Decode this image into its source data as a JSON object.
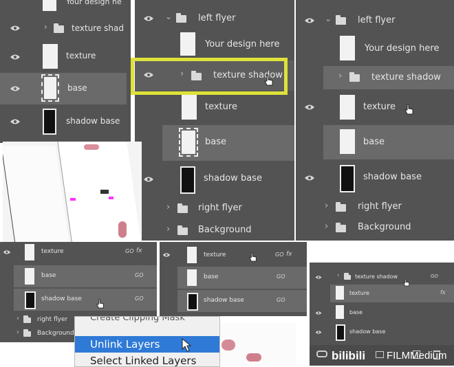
{
  "panel_a": {
    "partial_label": "Your design he",
    "layers": [
      {
        "label": "texture shad",
        "kind": "group"
      },
      {
        "label": "texture",
        "kind": "layer"
      },
      {
        "label": "base",
        "kind": "layer"
      },
      {
        "label": "shadow base",
        "kind": "layer"
      }
    ]
  },
  "panel_b": {
    "layers": [
      {
        "label": "left flyer",
        "kind": "group-open"
      },
      {
        "label": "Your design here",
        "kind": "smart"
      },
      {
        "label": "texture shadow",
        "kind": "group"
      },
      {
        "label": "texture",
        "kind": "layer"
      },
      {
        "label": "base",
        "kind": "layer"
      },
      {
        "label": "shadow base",
        "kind": "layer"
      },
      {
        "label": "right flyer",
        "kind": "group"
      },
      {
        "label": "Background",
        "kind": "group"
      }
    ],
    "highlight_color": "#dde23a"
  },
  "panel_c": {
    "layers": [
      {
        "label": "left flyer",
        "kind": "group-open"
      },
      {
        "label": "Your design here",
        "kind": "smart"
      },
      {
        "label": "texture shadow",
        "kind": "group"
      },
      {
        "label": "texture",
        "kind": "layer"
      },
      {
        "label": "base",
        "kind": "layer"
      },
      {
        "label": "shadow base",
        "kind": "layer"
      },
      {
        "label": "right flyer",
        "kind": "group"
      },
      {
        "label": "Background",
        "kind": "group"
      }
    ]
  },
  "panel_d": {
    "layers": [
      {
        "label": "texture",
        "kind": "layer"
      },
      {
        "label": "base",
        "kind": "layer"
      },
      {
        "label": "shadow base",
        "kind": "layer"
      },
      {
        "label": "right flyer",
        "kind": "group"
      },
      {
        "label": "Background",
        "kind": "group"
      }
    ],
    "link_symbol": "GO",
    "fx_symbol": "fx"
  },
  "panel_e": {
    "layers": [
      {
        "label": "texture",
        "kind": "layer"
      },
      {
        "label": "base",
        "kind": "layer"
      },
      {
        "label": "shadow base",
        "kind": "layer"
      }
    ],
    "link_symbol": "GO",
    "fx_symbol": "fx"
  },
  "panel_f": {
    "layers": [
      {
        "label": "texture shadow",
        "kind": "group"
      },
      {
        "label": "texture",
        "kind": "layer"
      },
      {
        "label": "base",
        "kind": "layer"
      },
      {
        "label": "shadow base",
        "kind": "layer"
      }
    ],
    "link_symbol": "GO",
    "fx_symbol": "fx"
  },
  "context_menu": {
    "items": [
      "Create Clipping Mask",
      "Unlink Layers",
      "Select Linked Layers"
    ],
    "active_index": 1,
    "active_color": "#2f7ad6"
  },
  "watermark": {
    "brand": "bilibili",
    "channel": "FILMMedium"
  },
  "colors": {
    "panel_bg": "#535353",
    "selected_row": "#6a6a6a",
    "text": "#e6e6e6"
  }
}
